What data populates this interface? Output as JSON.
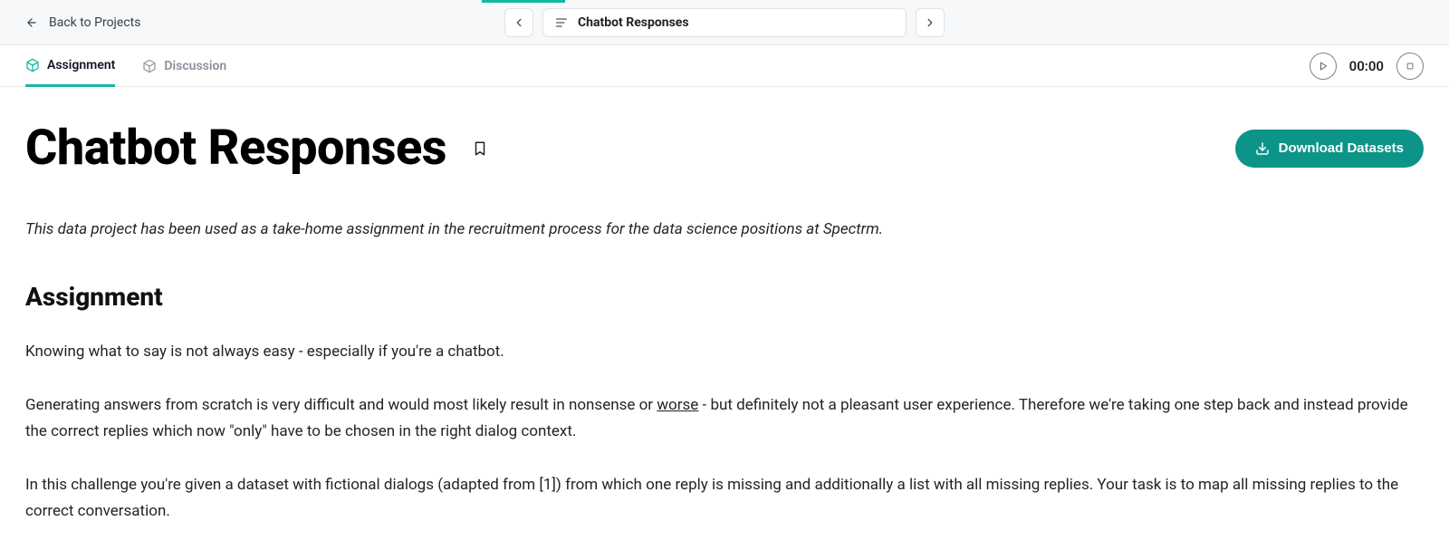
{
  "topbar": {
    "back_label": "Back to Projects",
    "pill_title": "Chatbot Responses"
  },
  "tabs": {
    "assignment": "Assignment",
    "discussion": "Discussion"
  },
  "timer": "00:00",
  "page": {
    "title": "Chatbot Responses",
    "download_label": "Download Datasets",
    "intro": "This data project has been used as a take-home assignment in the recruitment process for the data science positions at Spectrm.",
    "section_heading": "Assignment",
    "p1": "Knowing what to say is not always easy - especially if you're a chatbot.",
    "p2_a": "Generating answers from scratch is very difficult and would most likely result in nonsense or ",
    "p2_u": "worse",
    "p2_b": " - but definitely not a pleasant user experience. Therefore we're taking one step back and instead provide the correct replies which now \"only\" have to be chosen in the right dialog context.",
    "p3": "In this challenge you're given a dataset with fictional dialogs (adapted from [1]) from which one reply is missing and additionally a list with all missing replies. Your task is to map all missing replies to the correct conversation."
  }
}
